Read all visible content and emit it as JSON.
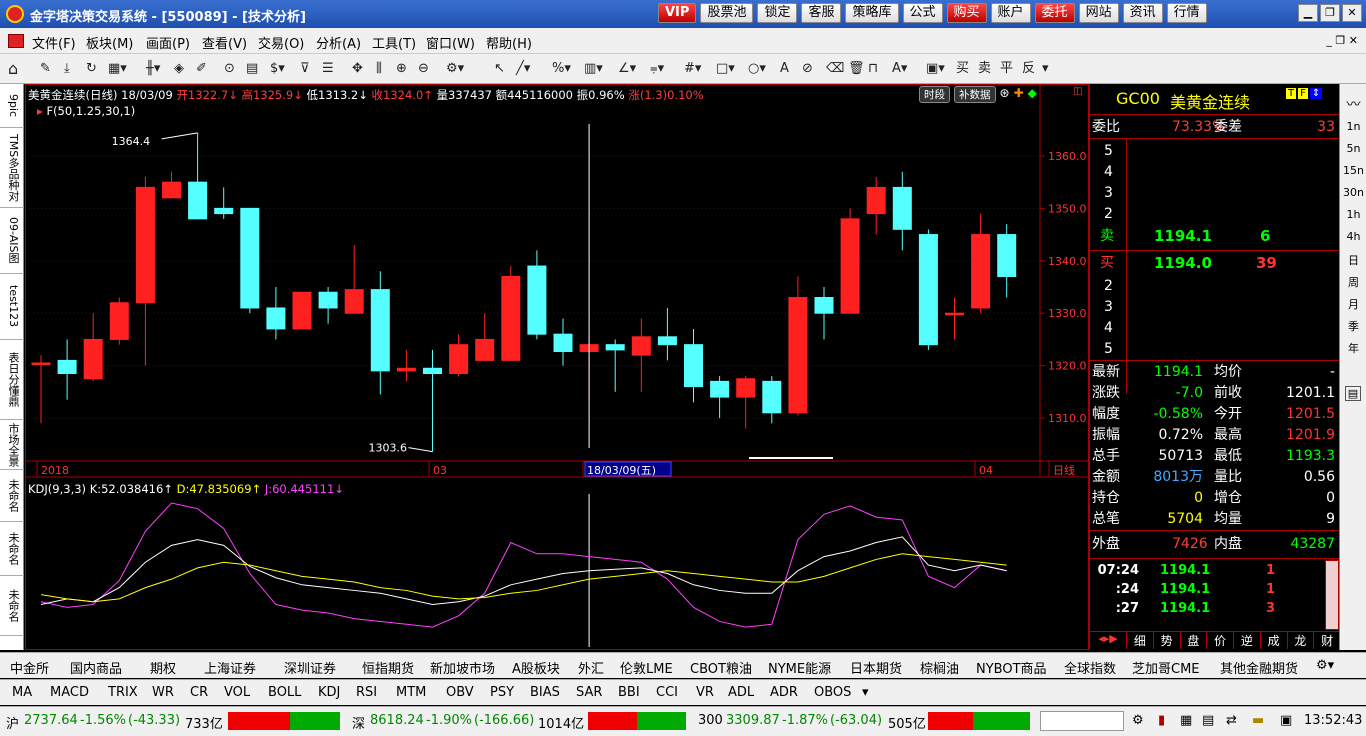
{
  "window": {
    "title": "金字塔决策交易系统 - [550089] - [技术分析]"
  },
  "top_buttons": [
    "VIP",
    "股票池",
    "锁定",
    "客服",
    "策略库",
    "公式",
    "购买",
    "账户",
    "委托",
    "网站",
    "资讯",
    "行情"
  ],
  "menu": [
    "文件(F)",
    "板块(M)",
    "画面(P)",
    "查看(V)",
    "交易(O)",
    "分析(A)",
    "工具(T)",
    "窗口(W)",
    "帮助(H)"
  ],
  "toolbar_text": [
    "买",
    "卖",
    "平",
    "反"
  ],
  "left_tabs": [
    "9pic",
    "TMS多品种对",
    "09-AIS图",
    "test123",
    "表日分懂鼎",
    "市场全景",
    "未命名",
    "未命名",
    "未命名"
  ],
  "chart": {
    "header": {
      "name": "美黄金连续(日线) 18/03/09",
      "open": "开1322.7↓",
      "high": "高1325.9↓",
      "low": "低1313.2↓",
      "close": "收1324.0↑",
      "vol": "量337437",
      "amt": "额445116000",
      "amp": "振0.96%",
      "chg": "涨(1.3)0.10%"
    },
    "subtitle": "F(50,1.25,30,1)",
    "buttons": [
      "时段",
      "补数据"
    ],
    "high_label": "1364.4",
    "low_label": "1303.6",
    "x_labels": [
      "2018",
      "03",
      "18/03/09(五)",
      "04",
      "日线"
    ],
    "kdj_header": {
      "name": "KDJ(9,3,3)",
      "k": "K:52.038416↑",
      "d": "D:47.835069↑",
      "j": "J:60.445111↓"
    }
  },
  "chart_data": {
    "type": "candlestick",
    "ylim": [
      1302,
      1368
    ],
    "yticks": [
      1310.0,
      1320.0,
      1330.0,
      1340.0,
      1350.0,
      1360.0
    ],
    "candles": [
      {
        "o": 1320.5,
        "c": 1320.5,
        "h": 1322,
        "l": 1309
      },
      {
        "o": 1321,
        "c": 1318.5,
        "h": 1325,
        "l": 1313.5
      },
      {
        "o": 1317.5,
        "c": 1325,
        "h": 1330,
        "l": 1317
      },
      {
        "o": 1325,
        "c": 1332,
        "h": 1333,
        "l": 1324
      },
      {
        "o": 1332,
        "c": 1354,
        "h": 1356,
        "l": 1320
      },
      {
        "o": 1352,
        "c": 1355,
        "h": 1357,
        "l": 1352
      },
      {
        "o": 1355,
        "c": 1348,
        "h": 1364.4,
        "l": 1348
      },
      {
        "o": 1350,
        "c": 1349,
        "h": 1354,
        "l": 1348
      },
      {
        "o": 1350,
        "c": 1331,
        "h": 1350,
        "l": 1330
      },
      {
        "o": 1331,
        "c": 1327,
        "h": 1335,
        "l": 1325
      },
      {
        "o": 1327,
        "c": 1334,
        "h": 1334,
        "l": 1327
      },
      {
        "o": 1334,
        "c": 1331,
        "h": 1335,
        "l": 1328
      },
      {
        "o": 1330,
        "c": 1334.5,
        "h": 1343,
        "l": 1330
      },
      {
        "o": 1334.5,
        "c": 1319,
        "h": 1338,
        "l": 1314.5
      },
      {
        "o": 1319,
        "c": 1319.5,
        "h": 1323,
        "l": 1317
      },
      {
        "o": 1319.5,
        "c": 1318.5,
        "h": 1323,
        "l": 1303.6
      },
      {
        "o": 1318.5,
        "c": 1324,
        "h": 1326,
        "l": 1318
      },
      {
        "o": 1321,
        "c": 1325,
        "h": 1330,
        "l": 1321
      },
      {
        "o": 1321,
        "c": 1337,
        "h": 1339,
        "l": 1321
      },
      {
        "o": 1339,
        "c": 1326,
        "h": 1342,
        "l": 1325
      },
      {
        "o": 1326,
        "c": 1322.7,
        "h": 1329,
        "l": 1320
      },
      {
        "o": 1322.7,
        "c": 1324.0,
        "h": 1325.9,
        "l": 1313.2
      },
      {
        "o": 1324,
        "c": 1323,
        "h": 1325,
        "l": 1315
      },
      {
        "o": 1322,
        "c": 1325.5,
        "h": 1329,
        "l": 1315
      },
      {
        "o": 1325.5,
        "c": 1324,
        "h": 1331,
        "l": 1321
      },
      {
        "o": 1324,
        "c": 1316,
        "h": 1327,
        "l": 1313
      },
      {
        "o": 1317,
        "c": 1314,
        "h": 1318,
        "l": 1310
      },
      {
        "o": 1314,
        "c": 1317.5,
        "h": 1318,
        "l": 1308
      },
      {
        "o": 1317,
        "c": 1311,
        "h": 1318,
        "l": 1309
      },
      {
        "o": 1311,
        "c": 1333,
        "h": 1337,
        "l": 1310.5
      },
      {
        "o": 1333,
        "c": 1330,
        "h": 1335,
        "l": 1325
      },
      {
        "o": 1330,
        "c": 1348,
        "h": 1350,
        "l": 1330
      },
      {
        "o": 1349,
        "c": 1354,
        "h": 1356,
        "l": 1345
      },
      {
        "o": 1354,
        "c": 1346,
        "h": 1357,
        "l": 1342
      },
      {
        "o": 1345,
        "c": 1324,
        "h": 1346,
        "l": 1323
      },
      {
        "o": 1330,
        "c": 1330,
        "h": 1333,
        "l": 1325
      },
      {
        "o": 1331,
        "c": 1345,
        "h": 1349,
        "l": 1330
      },
      {
        "o": 1345,
        "c": 1337,
        "h": 1347,
        "l": 1333
      }
    ],
    "kdj": {
      "k": [
        28,
        32,
        30,
        40,
        58,
        70,
        74,
        70,
        55,
        47,
        42,
        40,
        38,
        36,
        32,
        28,
        30,
        34,
        42,
        46,
        50,
        52,
        53,
        54,
        50,
        42,
        38,
        36,
        36,
        52,
        62,
        66,
        72,
        76,
        56,
        52,
        56,
        52
      ],
      "d": [
        35,
        32,
        30,
        32,
        40,
        46,
        54,
        58,
        56,
        52,
        48,
        46,
        44,
        40,
        38,
        34,
        32,
        33,
        36,
        38,
        42,
        46,
        48,
        50,
        52,
        50,
        48,
        46,
        44,
        44,
        48,
        54,
        60,
        64,
        62,
        60,
        58,
        56
      ],
      "j": [
        30,
        26,
        28,
        45,
        80,
        100,
        96,
        82,
        50,
        28,
        24,
        22,
        18,
        16,
        14,
        12,
        20,
        36,
        72,
        64,
        64,
        62,
        60,
        58,
        46,
        26,
        16,
        12,
        14,
        74,
        92,
        98,
        90,
        88,
        48,
        40,
        56,
        52
      ],
      "ylim": [
        0,
        105
      ]
    }
  },
  "quote": {
    "code": "GC00",
    "name": "美黄金连续",
    "weibi_label": "委比",
    "weibi": "73.33%",
    "weicha_label": "委差",
    "weicha": "33",
    "ask_levels": [
      "5",
      "4",
      "3",
      "2"
    ],
    "ask_label": "卖",
    "ask_price": "1194.1",
    "ask_vol": "6",
    "bid_label": "买",
    "bid_price": "1194.0",
    "bid_vol": "39",
    "bid_levels": [
      "2",
      "3",
      "4",
      "5"
    ],
    "stats": [
      [
        "最新",
        "1194.1",
        "均价",
        "-"
      ],
      [
        "涨跌",
        "-7.0",
        "前收",
        "1201.1"
      ],
      [
        "幅度",
        "-0.58%",
        "今开",
        "1201.5"
      ],
      [
        "振幅",
        "0.72%",
        "最高",
        "1201.9"
      ],
      [
        "总手",
        "50713",
        "最低",
        "1193.3"
      ],
      [
        "金额",
        "8013万",
        "量比",
        "0.56"
      ],
      [
        "持仓",
        "0",
        "增仓",
        "0"
      ],
      [
        "总笔",
        "5704",
        "均量",
        "9"
      ]
    ],
    "waipan_label": "外盘",
    "waipan": "7426",
    "neipan_label": "内盘",
    "neipan": "43287",
    "ticks": [
      [
        "07:24",
        "1194.1",
        "1"
      ],
      [
        ":24",
        "1194.1",
        "1"
      ],
      [
        ":27",
        "1194.1",
        "3"
      ]
    ],
    "bottom_tabs": [
      "细",
      "势",
      "盘",
      "价",
      "逆",
      "成",
      "龙",
      "财"
    ]
  },
  "right_bar": [
    "1n",
    "5n",
    "15n",
    "30n",
    "1h",
    "4h",
    "日",
    "周",
    "月",
    "季",
    "年"
  ],
  "bottom_tabs": [
    "中金所",
    "国内商品",
    "期权",
    "上海证券",
    "深圳证券",
    "恒指期货",
    "新加坡市场",
    "A股板块",
    "外汇",
    "伦敦LME",
    "CBOT粮油",
    "NYME能源",
    "日本期货",
    "棕榈油",
    "NYBOT商品",
    "全球指数",
    "芝加哥CME",
    "其他金融期货"
  ],
  "ind_tabs": [
    "MA",
    "MACD",
    "TRIX",
    "WR",
    "CR",
    "VOL",
    "BOLL",
    "KDJ",
    "RSI",
    "MTM",
    "OBV",
    "PSY",
    "BIAS",
    "SAR",
    "BBI",
    "CCI",
    "VR",
    "ADL",
    "ADR",
    "OBOS"
  ],
  "status": {
    "sh": "沪",
    "sh_val": "2737.64",
    "sh_chg": "-1.56%",
    "sh_pts": "(-43.33)",
    "sh_amt": "733亿",
    "sz": "深",
    "sz_val": "8618.24",
    "sz_chg": "-1.90%",
    "sz_pts": "(-166.66)",
    "sz_amt": "1014亿",
    "c3": "300",
    "c3_val": "3309.87",
    "c3_chg": "-1.87%",
    "c3_pts": "(-63.04)",
    "c3_amt": "505亿",
    "time": "13:52:43"
  }
}
